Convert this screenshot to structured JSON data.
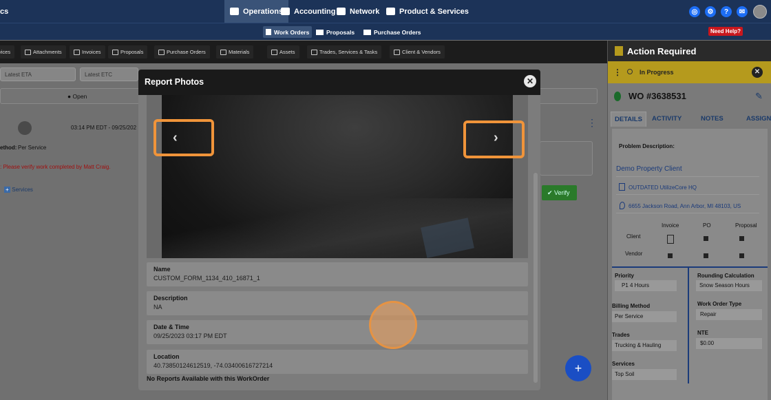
{
  "topnav": {
    "left_fragment": "cs",
    "items": [
      {
        "label": "Operations",
        "icon": "briefcase-icon"
      },
      {
        "label": "Accounting",
        "icon": "accounting-icon"
      },
      {
        "label": "Network",
        "icon": "network-icon"
      },
      {
        "label": "Product & Services",
        "icon": "product-icon"
      }
    ],
    "right_icons": [
      "lifebuoy-icon",
      "gear-icon",
      "help-icon",
      "chat-icon",
      "avatar"
    ]
  },
  "subnav": {
    "items": [
      {
        "label": "Work Orders",
        "icon": "work-order-icon"
      },
      {
        "label": "Proposals",
        "icon": "proposals-icon"
      },
      {
        "label": "Purchase Orders",
        "icon": "cart-icon"
      }
    ],
    "need_help": "Need Help?"
  },
  "tabs": [
    "vices",
    "Attachments",
    "Invoices",
    "Proposals",
    "Purchase Orders",
    "Materials",
    "Assets",
    "Trades, Services & Tasks",
    "Client & Vendors"
  ],
  "filters": {
    "latest_eta": "Latest ETA",
    "latest_etc": "Latest ETC"
  },
  "background": {
    "status": "Open",
    "timestamp": "03:14 PM EDT - 09/25/202",
    "method_label": "ethod:",
    "method_value": "Per Service",
    "note": ": Please verify work completed by Matt Craig.",
    "services": "Services",
    "verify": "Verify"
  },
  "modal": {
    "title": "Report Photos",
    "fields": [
      {
        "label": "Name",
        "value": "CUSTOM_FORM_1134_410_16871_1"
      },
      {
        "label": "Description",
        "value": "NA"
      },
      {
        "label": "Date & Time",
        "value": "09/25/2023 03:17 PM EDT"
      },
      {
        "label": "Location",
        "value": "40.73850124612519, -74.03400616727214"
      }
    ],
    "footer": "No Reports Available with this WorkOrder"
  },
  "right_panel": {
    "title": "Action Required",
    "status": "In Progress",
    "wo_number": "WO #3638531",
    "tabs": [
      "DETAILS",
      "ACTIVITY",
      "NOTES",
      "ASSIGNEE"
    ],
    "problem_description_label": "Problem Description:",
    "client_name": "Demo Property Client",
    "location_name": "OUTDATED UtilizeCore HQ",
    "address": "6655 Jackson Road, Ann Arbor, MI 48103, US",
    "grid_headers": [
      "Invoice",
      "PO",
      "Proposal"
    ],
    "grid_rows": [
      "Client",
      "Vendor"
    ],
    "fields_left": [
      {
        "label": "Priority",
        "value": "P1 4 Hours"
      },
      {
        "label": "Billing Method",
        "value": "Per Service"
      },
      {
        "label": "Trades",
        "value": "Trucking & Hauling"
      },
      {
        "label": "Services",
        "value": "Top Soil"
      }
    ],
    "fields_right": [
      {
        "label": "Rounding Calculation",
        "value": "Snow Season Hours"
      },
      {
        "label": "Work Order Type",
        "value": "Repair"
      },
      {
        "label": "NTE",
        "value": "$0.00"
      }
    ]
  },
  "fab_label": "+"
}
